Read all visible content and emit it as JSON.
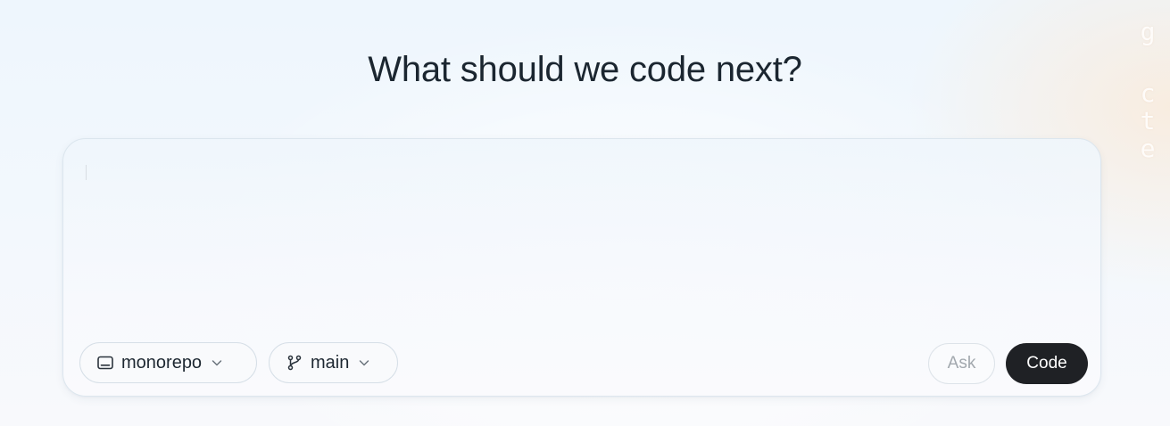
{
  "side_decoration": {
    "chars": [
      "g",
      "c",
      "t",
      "e"
    ]
  },
  "header": {
    "title": "What should we code next?"
  },
  "composer": {
    "input_value": "",
    "repo_selector": {
      "icon": "terminal-window-icon",
      "label": "monorepo"
    },
    "branch_selector": {
      "icon": "git-branch-icon",
      "label": "main"
    },
    "actions": {
      "ask_label": "Ask",
      "code_label": "Code"
    }
  },
  "colors": {
    "primary_button": "#1f2125",
    "primary_button_text": "#ffffff",
    "disabled_text": "#a2a8ae",
    "title_text": "#1b2630"
  }
}
